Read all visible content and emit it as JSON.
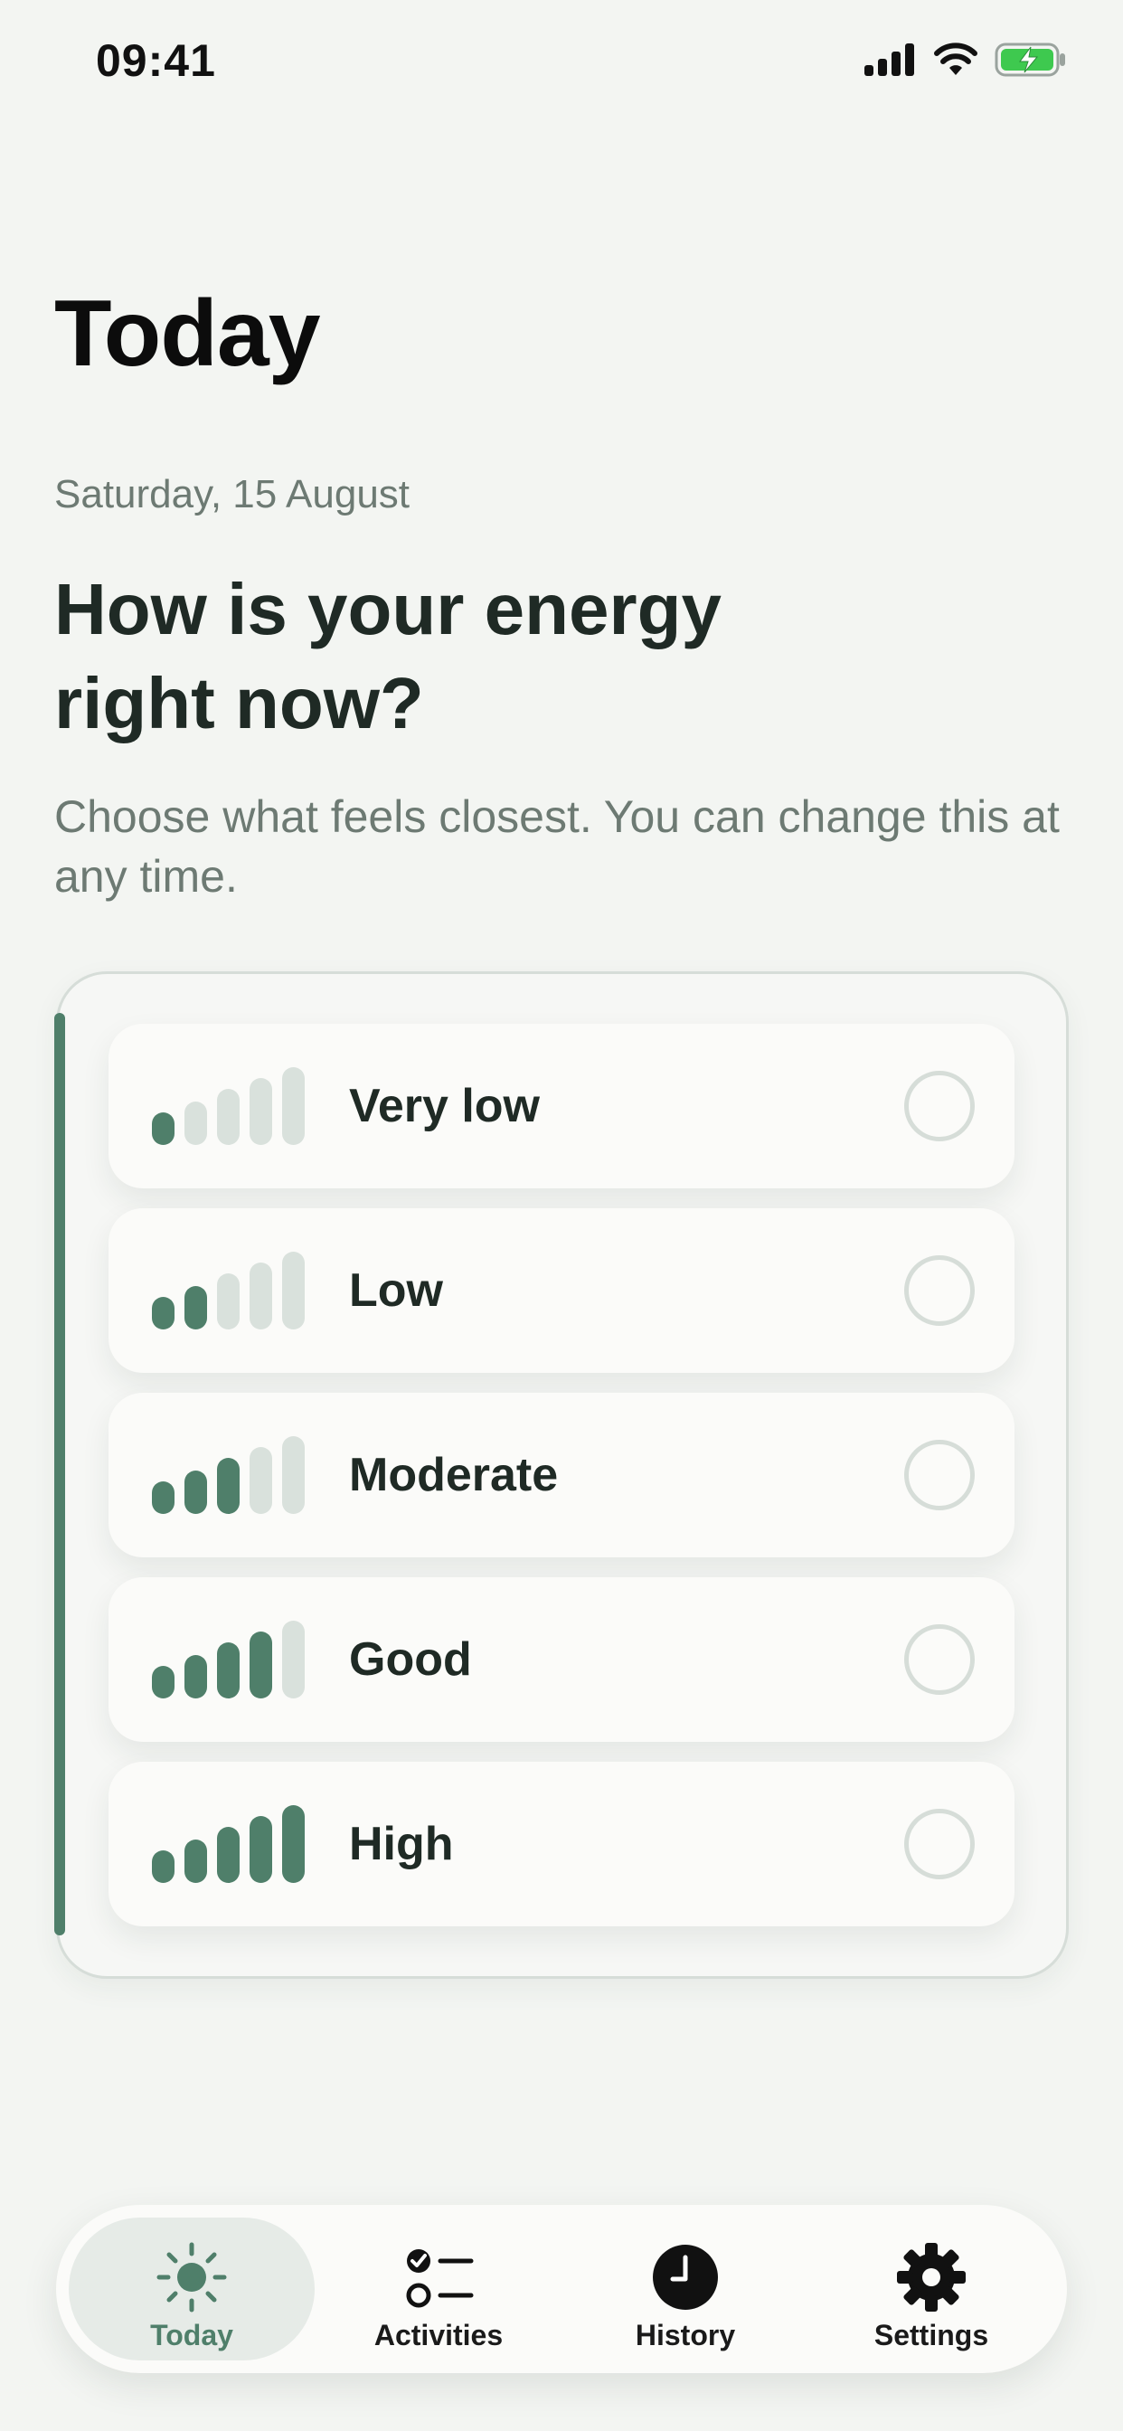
{
  "status_bar": {
    "time": "09:41"
  },
  "header": {
    "title": "Today"
  },
  "content": {
    "date": "Saturday, 15 August",
    "question": "How is your energy right now?",
    "hint": "Choose what feels closest. You can change this at any time."
  },
  "energy_options": [
    {
      "label": "Very low",
      "level": 1,
      "selected": false
    },
    {
      "label": "Low",
      "level": 2,
      "selected": false
    },
    {
      "label": "Moderate",
      "level": 3,
      "selected": false
    },
    {
      "label": "Good",
      "level": 4,
      "selected": false
    },
    {
      "label": "High",
      "level": 5,
      "selected": false
    }
  ],
  "tab_bar": {
    "tabs": [
      {
        "label": "Today",
        "icon": "sun-icon",
        "active": true
      },
      {
        "label": "Activities",
        "icon": "checklist-icon",
        "active": false
      },
      {
        "label": "History",
        "icon": "clock-icon",
        "active": false
      },
      {
        "label": "Settings",
        "icon": "gear-icon",
        "active": false
      }
    ]
  },
  "colors": {
    "accent": "#4f7f6a",
    "background": "#f3f5f2",
    "muted_text": "#6d7a73",
    "inactive_bar": "#d9e1dc"
  }
}
